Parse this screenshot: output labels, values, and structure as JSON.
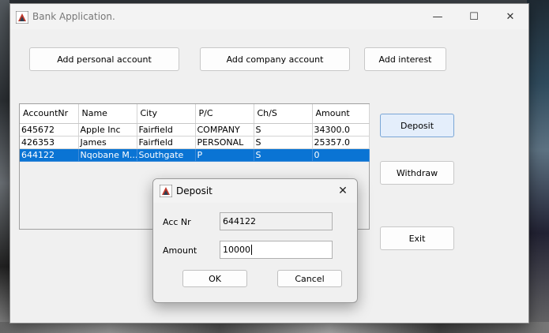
{
  "window": {
    "title": "Bank Application.",
    "controls": {
      "minimize": "—",
      "maximize": "☐",
      "close": "✕"
    }
  },
  "toolbar": {
    "add_personal": "Add personal account",
    "add_company": "Add company account",
    "add_interest": "Add interest"
  },
  "side_buttons": {
    "deposit": "Deposit",
    "withdraw": "Withdraw",
    "exit": "Exit"
  },
  "table": {
    "headers": [
      "AccountNr",
      "Name",
      "City",
      "P/C",
      "Ch/S",
      "Amount"
    ],
    "rows": [
      [
        "645672",
        "Apple Inc",
        "Fairfield",
        "COMPANY",
        "S",
        "34300.0"
      ],
      [
        "426353",
        "James",
        "Fairfield",
        "PERSONAL",
        "S",
        "25357.0"
      ],
      [
        "644122",
        "Nqobane M...",
        "Southgate",
        "P",
        "S",
        "0"
      ]
    ],
    "selected_row": 2
  },
  "dialog": {
    "title": "Deposit",
    "acc_label": "Acc Nr",
    "acc_value": "644122",
    "amount_label": "Amount",
    "amount_value": "10000",
    "ok": "OK",
    "cancel": "Cancel"
  },
  "colors": {
    "selection": "#0a74d4",
    "window_bg": "#f0f0f0"
  }
}
